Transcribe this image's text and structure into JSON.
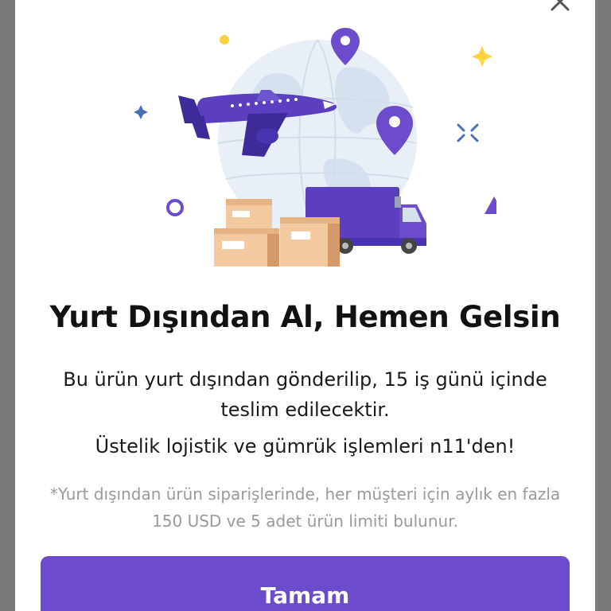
{
  "dialog": {
    "title": "Yurt Dışından Al, Hemen Gelsin",
    "description": "Bu ürün yurt dışından gönderilip, 15 iş günü içinde teslim edilecektir.",
    "extra": "Üstelik lojistik ve gümrük işlemleri n11'den!",
    "note": "*Yurt dışından ürün siparişlerinde, her müşteri için aylık en fazla 150 USD ve 5 adet ürün limiti bulunur.",
    "confirm_label": "Tamam",
    "close_icon": "close-icon"
  },
  "colors": {
    "accent": "#6c4ccc",
    "overlay": "#7a7a7a",
    "globe": "#e8eef6",
    "box": "#f3c9a0",
    "star_yellow": "#ffd23f"
  }
}
